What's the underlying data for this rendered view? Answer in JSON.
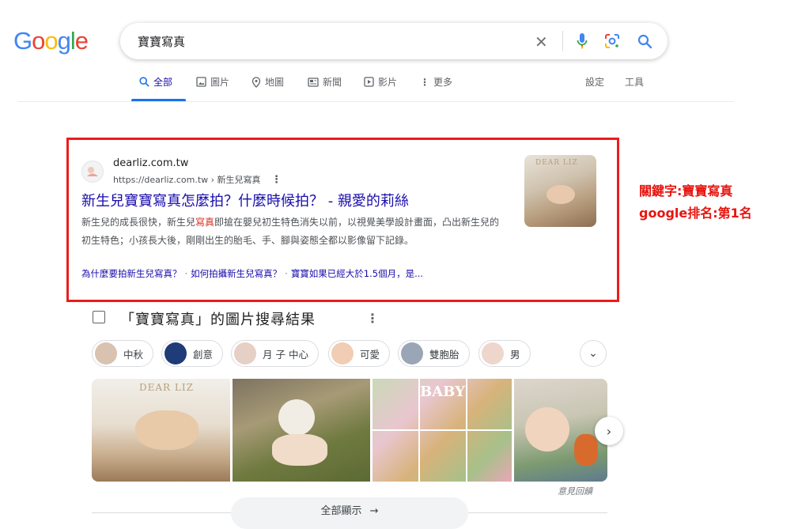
{
  "logo": {
    "letters": [
      "G",
      "o",
      "o",
      "g",
      "l",
      "e"
    ],
    "colors": [
      "#4285F4",
      "#EA4335",
      "#FBBC05",
      "#4285F4",
      "#34A853",
      "#EA4335"
    ]
  },
  "search": {
    "query": "寶寶寫真",
    "clear_icon": "close-icon",
    "mic_icon": "mic-icon",
    "lens_icon": "lens-icon",
    "search_icon": "search-icon"
  },
  "tabs": [
    {
      "label": "全部",
      "icon": "search-icon",
      "active": true
    },
    {
      "label": "圖片",
      "icon": "image-icon"
    },
    {
      "label": "地圖",
      "icon": "pin-icon"
    },
    {
      "label": "新聞",
      "icon": "news-icon"
    },
    {
      "label": "影片",
      "icon": "play-icon"
    },
    {
      "label": "更多",
      "icon": "more-vert-icon"
    }
  ],
  "settings": {
    "label": "設定"
  },
  "tools": {
    "label": "工具"
  },
  "result": {
    "site_name": "dearliz.com.tw",
    "url": "https://dearliz.com.tw",
    "breadcrumb": "新生兒寫真",
    "title": "新生兒寶寶寫真怎麼拍？什麼時候拍？ - 親愛的莉絲",
    "snippet_a": "新生兒的成長很快，新生兒",
    "snippet_em": "寫真",
    "snippet_b": "即搶在嬰兒初生特色消失以前，以視覺美學設計畫面，凸出新生兒的初生特色；小孩長大後，剛剛出生的胎毛、手、腳與姿態全都以影像留下記錄。",
    "sitelinks": [
      "為什麼要拍新生兒寫真？",
      "如何拍攝新生兒寫真？",
      "寶寶如果已經大於1.5個月，是..."
    ],
    "thumb_text": "DEAR LIZ"
  },
  "annotation": {
    "line1": "關鍵字:寶寶寫真",
    "line2": "google排名:第1名"
  },
  "images": {
    "heading": "「寶寶寫真」的圖片搜尋結果",
    "chips": [
      "中秋",
      "創意",
      "月 子 中心",
      "可愛",
      "雙胞胎",
      "男"
    ],
    "photo_texts": [
      "DEAR LIZ",
      "",
      "BABY",
      ""
    ],
    "feedback": "意見回饋",
    "show_all": "全部顯示"
  },
  "colors": {
    "link": "#1a0dab",
    "annotation": "#e8140f",
    "highlight_box": "#ee1b1b"
  }
}
